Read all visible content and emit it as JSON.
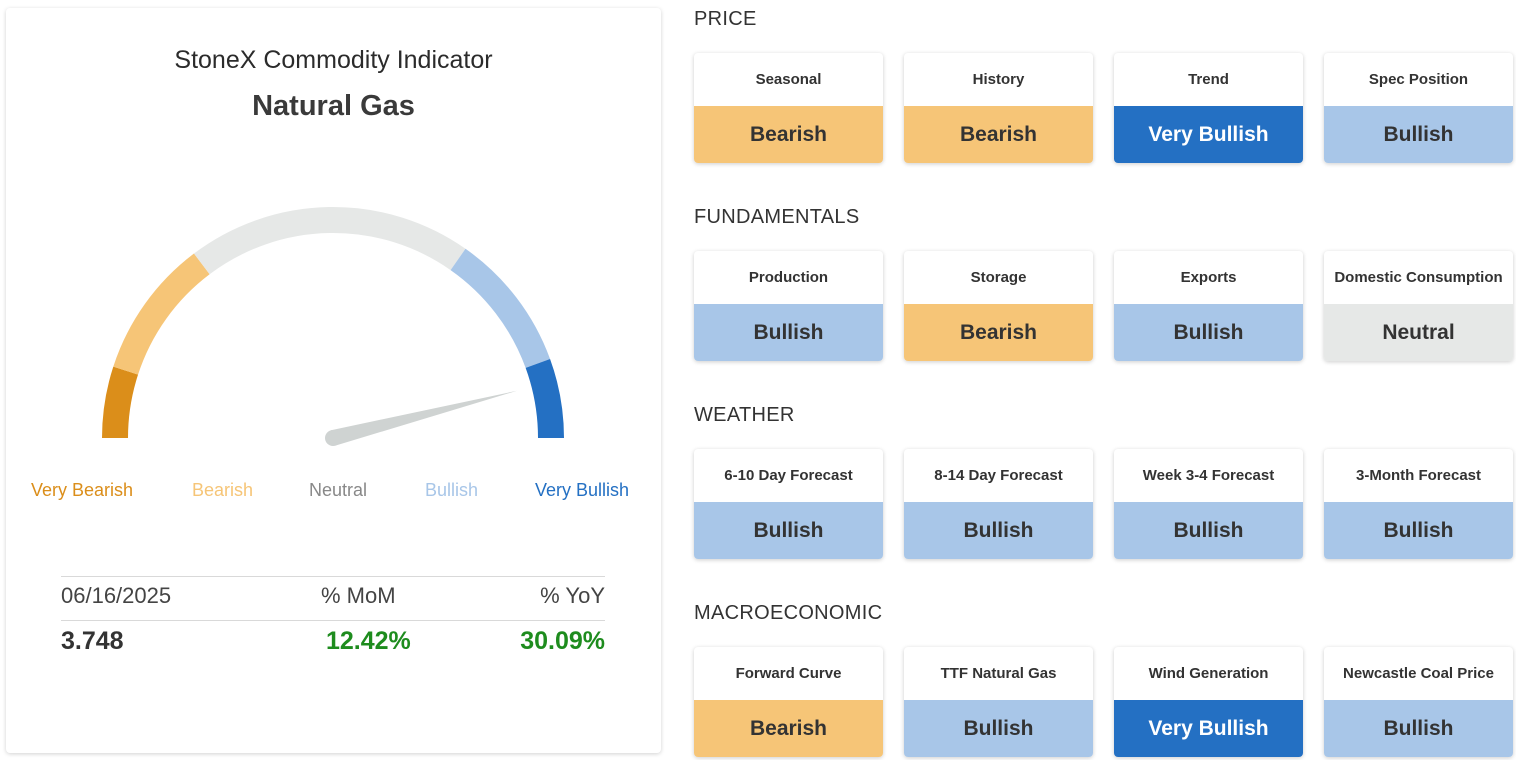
{
  "colors": {
    "very_bearish": "#db8e1a",
    "bearish": "#f6c577",
    "neutral": "#e6e8e7",
    "bullish": "#a8c6e8",
    "very_bullish": "#2470c3",
    "neutral_text": "#888888",
    "positive": "#1e8c1e"
  },
  "indicator": {
    "title": "StoneX Commodity Indicator",
    "commodity": "Natural Gas",
    "reading": 0.92,
    "scale": [
      "Very Bearish",
      "Bearish",
      "Neutral",
      "Bullish",
      "Very Bullish"
    ]
  },
  "stats": {
    "date": "06/16/2025",
    "mom_label": "% MoM",
    "yoy_label": "% YoY",
    "price": "3.748",
    "mom": "12.42%",
    "yoy": "30.09%"
  },
  "sections": [
    {
      "title": "PRICE",
      "cards": [
        {
          "label": "Seasonal",
          "value": "Bearish",
          "level": "bearish"
        },
        {
          "label": "History",
          "value": "Bearish",
          "level": "bearish"
        },
        {
          "label": "Trend",
          "value": "Very Bullish",
          "level": "very_bullish"
        },
        {
          "label": "Spec Position",
          "value": "Bullish",
          "level": "bullish"
        }
      ]
    },
    {
      "title": "FUNDAMENTALS",
      "cards": [
        {
          "label": "Production",
          "value": "Bullish",
          "level": "bullish"
        },
        {
          "label": "Storage",
          "value": "Bearish",
          "level": "bearish"
        },
        {
          "label": "Exports",
          "value": "Bullish",
          "level": "bullish"
        },
        {
          "label": "Domestic Consumption",
          "value": "Neutral",
          "level": "neutral"
        }
      ]
    },
    {
      "title": "WEATHER",
      "cards": [
        {
          "label": "6-10 Day Forecast",
          "value": "Bullish",
          "level": "bullish"
        },
        {
          "label": "8-14 Day Forecast",
          "value": "Bullish",
          "level": "bullish"
        },
        {
          "label": "Week 3-4 Forecast",
          "value": "Bullish",
          "level": "bullish"
        },
        {
          "label": "3-Month Forecast",
          "value": "Bullish",
          "level": "bullish"
        }
      ]
    },
    {
      "title": "MACROECONOMIC",
      "cards": [
        {
          "label": "Forward Curve",
          "value": "Bearish",
          "level": "bearish"
        },
        {
          "label": "TTF Natural Gas",
          "value": "Bullish",
          "level": "bullish"
        },
        {
          "label": "Wind Generation",
          "value": "Very Bullish",
          "level": "very_bullish"
        },
        {
          "label": "Newcastle Coal Price",
          "value": "Bullish",
          "level": "bullish"
        }
      ]
    }
  ]
}
